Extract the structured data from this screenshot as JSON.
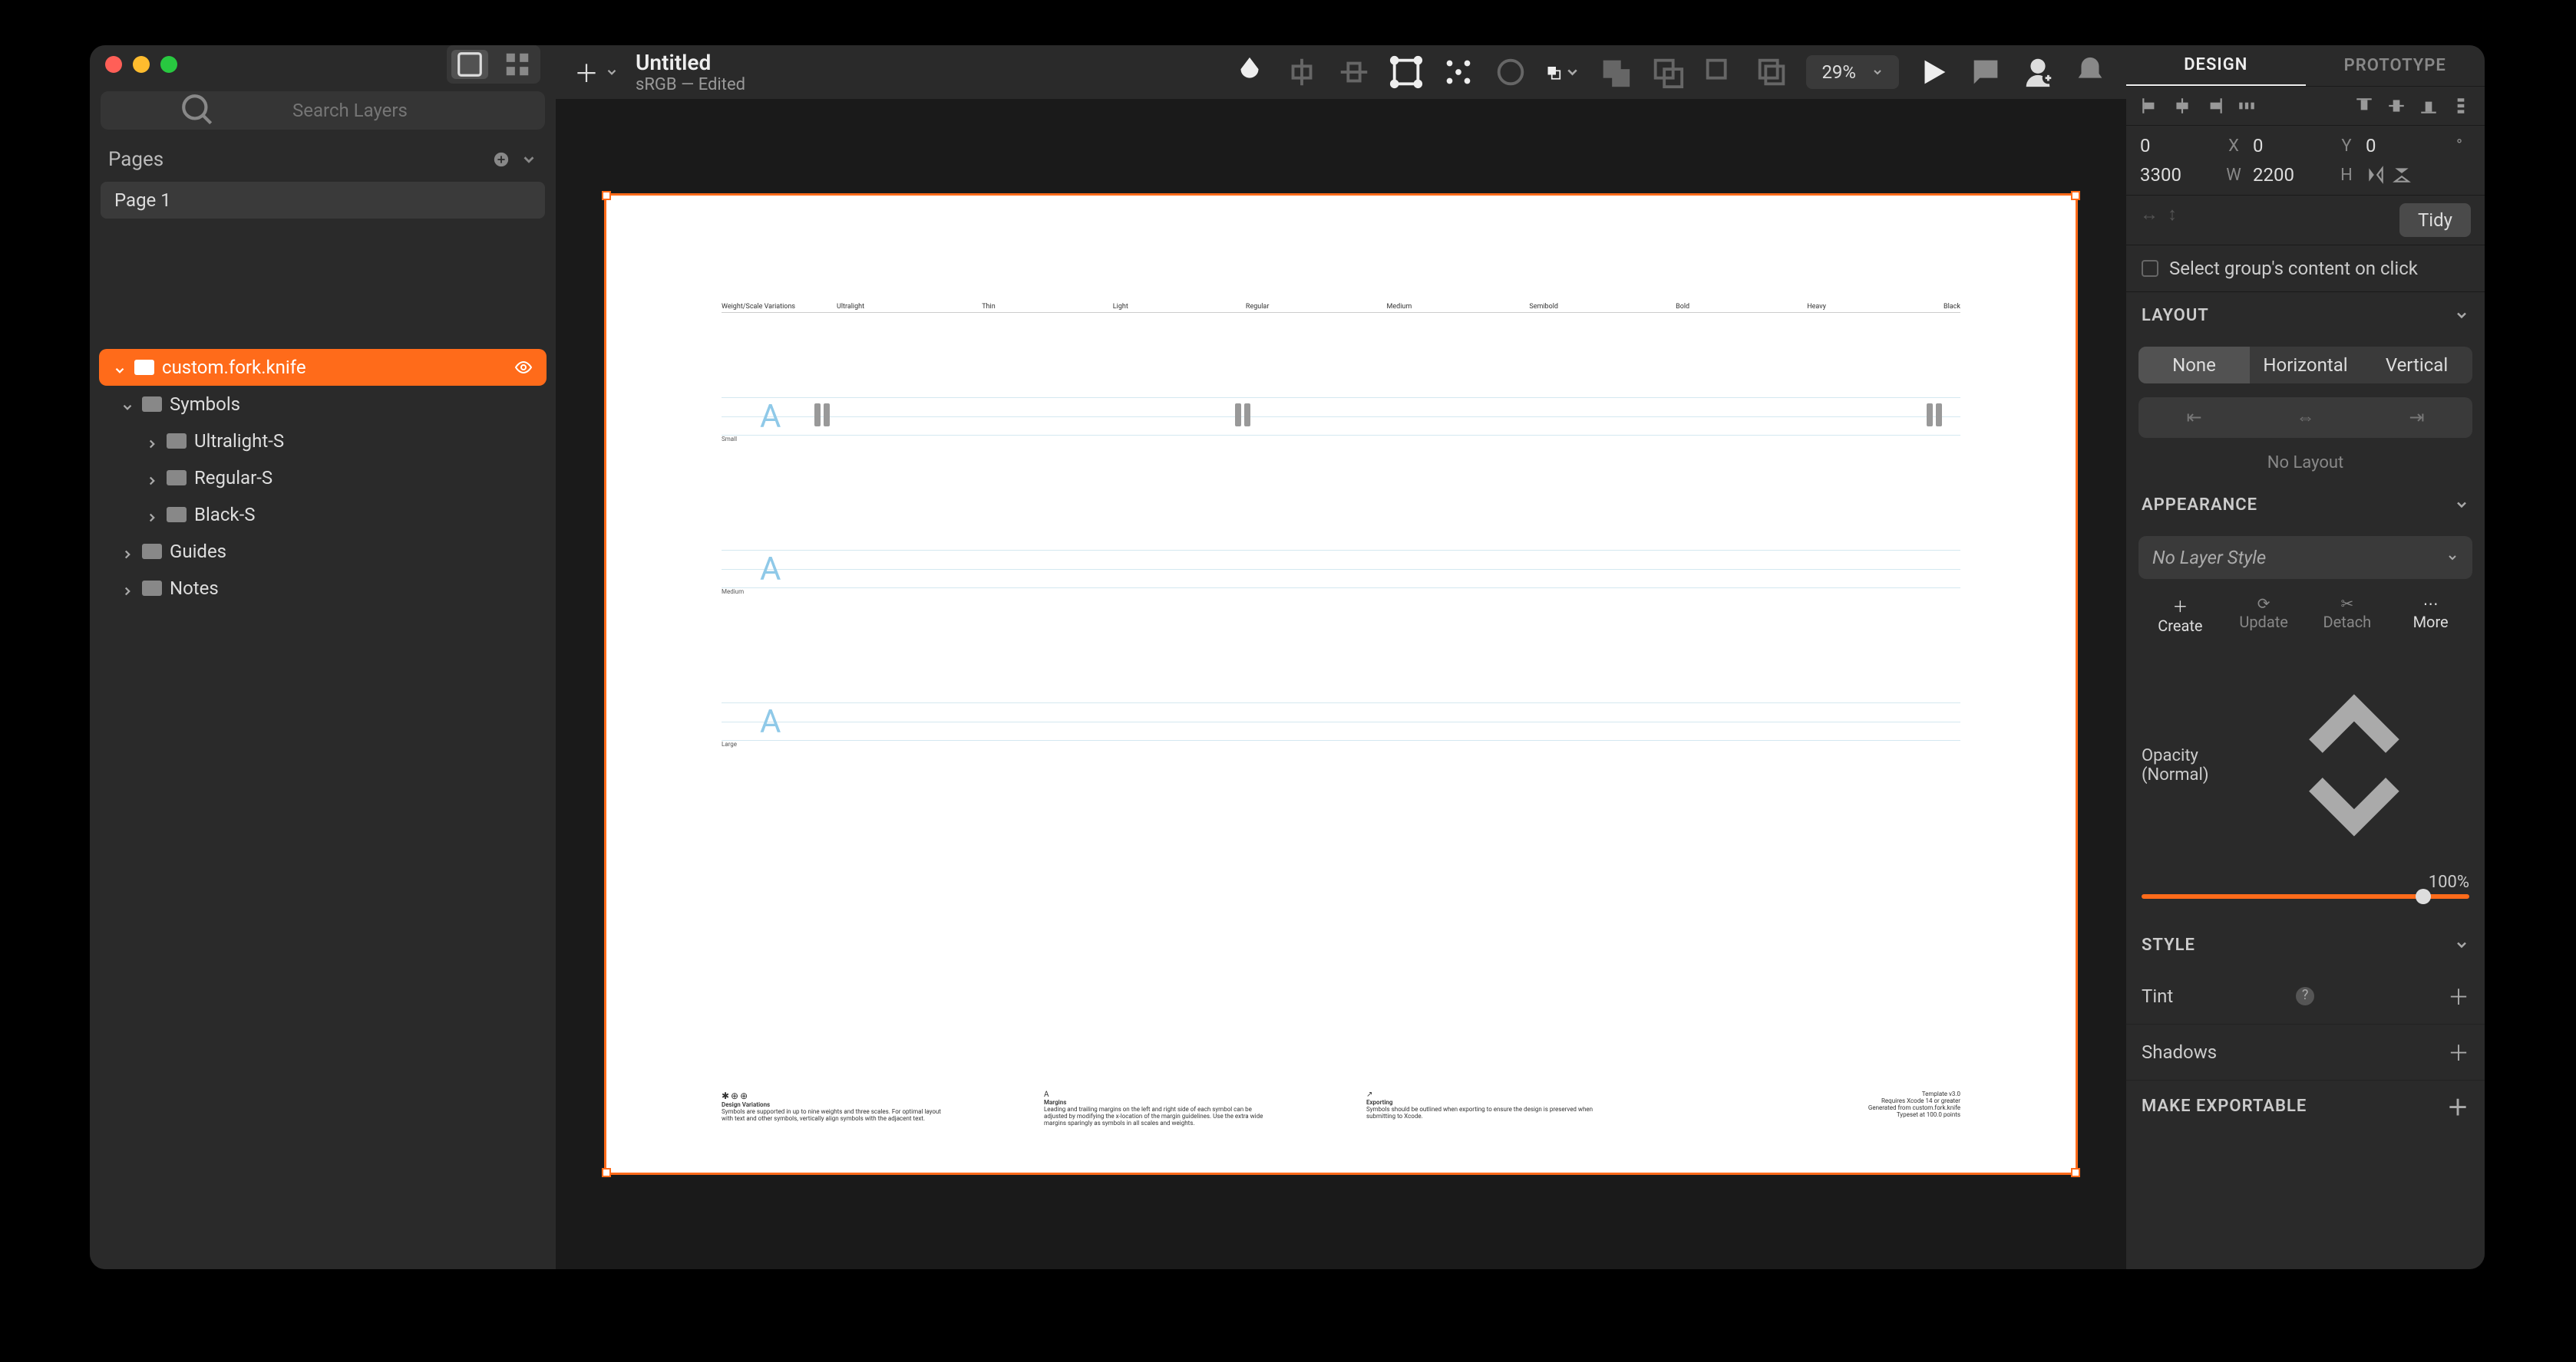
{
  "document": {
    "title": "Untitled",
    "subtitle": "sRGB — Edited"
  },
  "search_placeholder": "Search Layers",
  "pages_header": "Pages",
  "pages": [
    "Page 1"
  ],
  "zoom": "29%",
  "layers": {
    "selected": "custom.fork.knife",
    "children": [
      {
        "name": "Symbols",
        "children": [
          "Ultralight-S",
          "Regular-S",
          "Black-S"
        ]
      },
      {
        "name": "Guides"
      },
      {
        "name": "Notes"
      }
    ]
  },
  "canvas": {
    "weight_header": "Weight/Scale Variations",
    "weights": [
      "Ultralight",
      "Thin",
      "Light",
      "Regular",
      "Medium",
      "Semibold",
      "Bold",
      "Heavy",
      "Black"
    ],
    "rows": [
      "Small",
      "Medium",
      "Large"
    ],
    "footer": [
      {
        "title": "Design Variations",
        "body": "Symbols are supported in up to nine weights and three scales. For optimal layout with text and other symbols, vertically align symbols with the adjacent text."
      },
      {
        "title": "Margins",
        "body": "Leading and trailing margins on the left and right side of each symbol can be adjusted by modifying the x-location of the margin guidelines. Use the extra wide margins sparingly as symbols in all scales and weights."
      },
      {
        "title": "Exporting",
        "body": "Symbols should be outlined when exporting to ensure the design is preserved when submitting to Xcode."
      }
    ],
    "footer_right": [
      "Template v3.0",
      "Requires Xcode 14 or greater",
      "Generated from custom.fork.knife",
      "Typeset at 100.0 points"
    ]
  },
  "inspector": {
    "tabs": [
      "DESIGN",
      "PROTOTYPE"
    ],
    "position": {
      "x": "0",
      "y": "0",
      "rotation": "0",
      "w": "3300",
      "h": "2200"
    },
    "tidy": "Tidy",
    "select_group": "Select group's content on click",
    "layout": {
      "header": "LAYOUT",
      "options": [
        "None",
        "Horizontal",
        "Vertical"
      ],
      "status": "No Layout"
    },
    "appearance": {
      "header": "APPEARANCE",
      "style": "No Layer Style",
      "actions": [
        "Create",
        "Update",
        "Detach",
        "More"
      ]
    },
    "opacity": {
      "label": "Opacity (Normal)",
      "value": "100%"
    },
    "style": {
      "header": "STYLE",
      "rows": [
        "Tint",
        "Shadows"
      ]
    },
    "export": "MAKE EXPORTABLE"
  }
}
